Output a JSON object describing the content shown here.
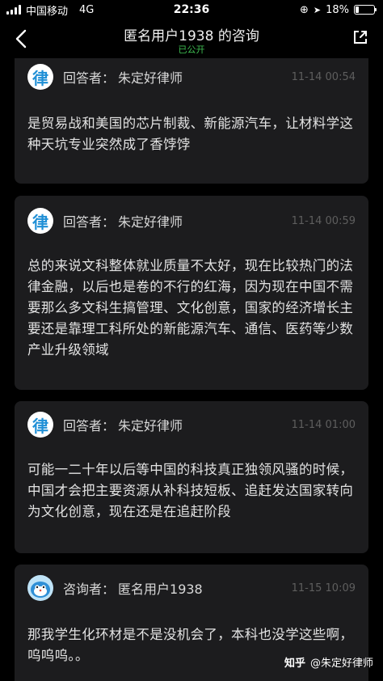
{
  "status": {
    "carrier": "中国移动",
    "network": "4G",
    "time": "22:36",
    "battery": "18%",
    "battery_level": 0.18
  },
  "nav": {
    "title": "匿名用户1938 的咨询",
    "subtitle": "已公开"
  },
  "messages": [
    {
      "role": "回答者：",
      "name": "朱定好律师",
      "time": "11-14 00:54",
      "avatar_char": "律",
      "text": "是贸易战和美国的芯片制裁、新能源汽车，让材料学这种天坑专业突然成了香饽饽"
    },
    {
      "role": "回答者：",
      "name": "朱定好律师",
      "time": "11-14 00:59",
      "avatar_char": "律",
      "text": "总的来说文科整体就业质量不太好，现在比较热门的法律金融，以后也是卷的不行的红海，因为现在中国不需要那么多文科生搞管理、文化创意，国家的经济增长主要还是靠理工科所处的新能源汽车、通信、医药等少数产业升级领域"
    },
    {
      "role": "回答者：",
      "name": "朱定好律师",
      "time": "11-14 01:00",
      "avatar_char": "律",
      "text": "可能一二十年以后等中国的科技真正独领风骚的时候，中国才会把主要资源从补科技短板、追赶发达国家转向为文化创意，现在还是在追赶阶段"
    },
    {
      "role": "咨询者：",
      "name": "匿名用户1938",
      "time": "11-15 10:09",
      "text": "那我学生化环材是不是没机会了，本科也没学这些啊，呜呜呜。。"
    }
  ],
  "watermark": {
    "brand": "知乎",
    "author": "@朱定好律师"
  },
  "colors": {
    "background": "#000000",
    "card": "#1c1c1e",
    "public_green": "#3fbf52",
    "lawyer_blue": "#1f8fd6"
  }
}
